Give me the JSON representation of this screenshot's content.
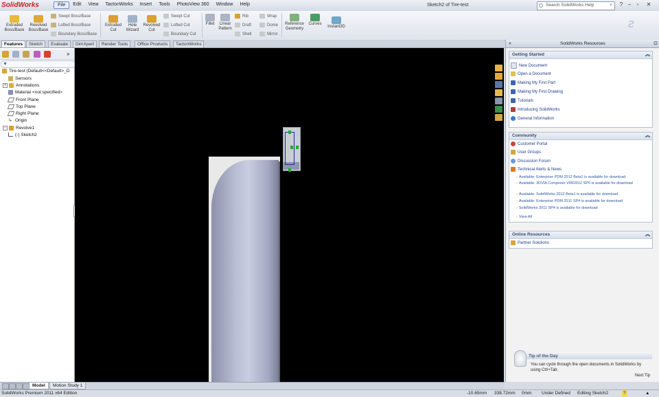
{
  "app": {
    "logo": "SolidWorks",
    "doc_title": "Sketch2 of Tire-test",
    "search_placeholder": "Search SolidWorks Help"
  },
  "menu": [
    "File",
    "Edit",
    "View",
    "TactonWorks",
    "Insert",
    "Tools",
    "PhotoView 360",
    "Window",
    "Help"
  ],
  "ribbon": {
    "extruded_boss": [
      "Extruded",
      "Boss/Base"
    ],
    "revolved_boss": [
      "Revolved",
      "Boss/Base"
    ],
    "swept_boss": "Swept Boss/Base",
    "lofted_boss": "Lofted Boss/Base",
    "boundary_boss": "Boundary Boss/Base",
    "extruded_cut": [
      "Extruded",
      "Cut"
    ],
    "hole_wizard": [
      "Hole",
      "Wizard"
    ],
    "revolved_cut": [
      "Revolved",
      "Cut"
    ],
    "swept_cut": "Swept Cut",
    "lofted_cut": "Lofted Cut",
    "boundary_cut": "Boundary Cut",
    "fillet": "Fillet",
    "linear_pattern": [
      "Linear",
      "Pattern"
    ],
    "rib": "Rib",
    "draft": "Draft",
    "shell": "Shell",
    "wrap": "Wrap",
    "dome": "Dome",
    "mirror": "Mirror",
    "reference_geometry": [
      "Reference",
      "Geometry"
    ],
    "curves": "Curves",
    "instant3d": "Instant3D"
  },
  "cm_tabs": [
    "Features",
    "Sketch",
    "Evaluate",
    "DimXpert",
    "Render Tools",
    "Office Products",
    "TactonWorks"
  ],
  "feature_tree": {
    "root": "Tire-test  (Default<<Default>_D",
    "items": [
      "Sensors",
      "Annotations",
      "Material <not specified>",
      "Front Plane",
      "Top Plane",
      "Right Plane",
      "Origin",
      "Revolve1",
      "(-) Sketch2"
    ]
  },
  "task_pane": {
    "title": "SolidWorks Resources",
    "getting_started": {
      "title": "Getting Started",
      "links": [
        "New Document",
        "Open a Document",
        "Making My First Part",
        "Making My First Drawing",
        "Tutorials",
        "Introducing SolidWorks",
        "General Information"
      ]
    },
    "community": {
      "title": "Community",
      "links": [
        "Customer Portal",
        "User Groups",
        "Discussion Forum",
        "Technical Alerts & News"
      ],
      "news": [
        "Available: Enterprise PDM 2012 Beta1 is available for download",
        "Available: 3DVIA Composer V6R2012 SP0 is available for download",
        "Available: SolidWorks 2012 Beta1 is available for download",
        "Available: Enterprise PDM 2011 SP4 is available for download",
        "SolidWorks 2011 SP4 is available for download"
      ],
      "view_all": "View All"
    },
    "online": {
      "title": "Online Resources",
      "links": [
        "Partner Solutions"
      ]
    },
    "tip": {
      "title": "Tip of the Day",
      "text": "You can cycle through the open documents in SolidWorks by using Ctrl+Tab.",
      "next": "Next Tip"
    }
  },
  "bottom_tabs": [
    "Model",
    "Motion Study 1"
  ],
  "status": {
    "edition": "SolidWorks Premium 2011 x64 Edition",
    "x": "-10.65mm",
    "y": "338.72mm",
    "z": "0mm",
    "state": "Under Defined",
    "editing": "Editing Sketch2"
  },
  "colors": {
    "viewport_bg": "#000000",
    "part_shade": "#b8bdd4",
    "sketch_line": "#1d2a9a",
    "handle": "#1ab21a",
    "link": "#1f3d8a"
  }
}
